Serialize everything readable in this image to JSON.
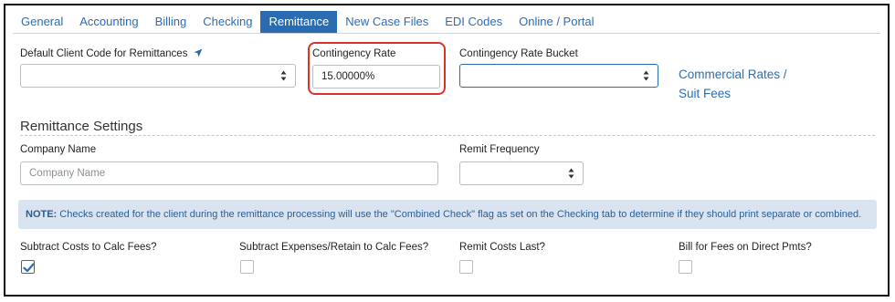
{
  "tabs": [
    {
      "label": "General",
      "active": false
    },
    {
      "label": "Accounting",
      "active": false
    },
    {
      "label": "Billing",
      "active": false
    },
    {
      "label": "Checking",
      "active": false
    },
    {
      "label": "Remittance",
      "active": true
    },
    {
      "label": "New Case Files",
      "active": false
    },
    {
      "label": "EDI Codes",
      "active": false
    },
    {
      "label": "Online / Portal",
      "active": false
    }
  ],
  "fields": {
    "default_client_code_label": "Default Client Code for Remittances",
    "default_client_code_value": "",
    "contingency_rate_label": "Contingency Rate",
    "contingency_rate_value": "15.00000%",
    "contingency_bucket_label": "Contingency Rate Bucket",
    "contingency_bucket_value": ""
  },
  "links": {
    "commercial_rates_line1": "Commercial Rates /",
    "commercial_rates_line2": "Suit Fees"
  },
  "remittance_settings": {
    "title": "Remittance Settings",
    "company_name_label": "Company Name",
    "company_name_placeholder": "Company Name",
    "company_name_value": "",
    "remit_frequency_label": "Remit Frequency",
    "remit_frequency_value": ""
  },
  "note": {
    "prefix": "NOTE:",
    "text": " Checks created for the client during the remittance processing will use the \"Combined Check\" flag as set on the Checking tab to determine if they should print separate or combined."
  },
  "checkboxes": [
    {
      "label": "Subtract Costs to Calc Fees?",
      "checked": true
    },
    {
      "label": "Subtract Expenses/Retain to Calc Fees?",
      "checked": false
    },
    {
      "label": "Remit Costs Last?",
      "checked": false
    },
    {
      "label": "Bill for Fees on Direct Pmts?",
      "checked": false
    }
  ],
  "colors": {
    "accent": "#2b6cb0",
    "link": "#2a6db5",
    "highlight": "#d9332b",
    "note_bg": "#d9e4f0"
  },
  "icons": {
    "client_code_hint": "arrow-pin-icon",
    "select_caret": "sort-caret-icon",
    "checkbox_check": "checkmark-icon"
  }
}
